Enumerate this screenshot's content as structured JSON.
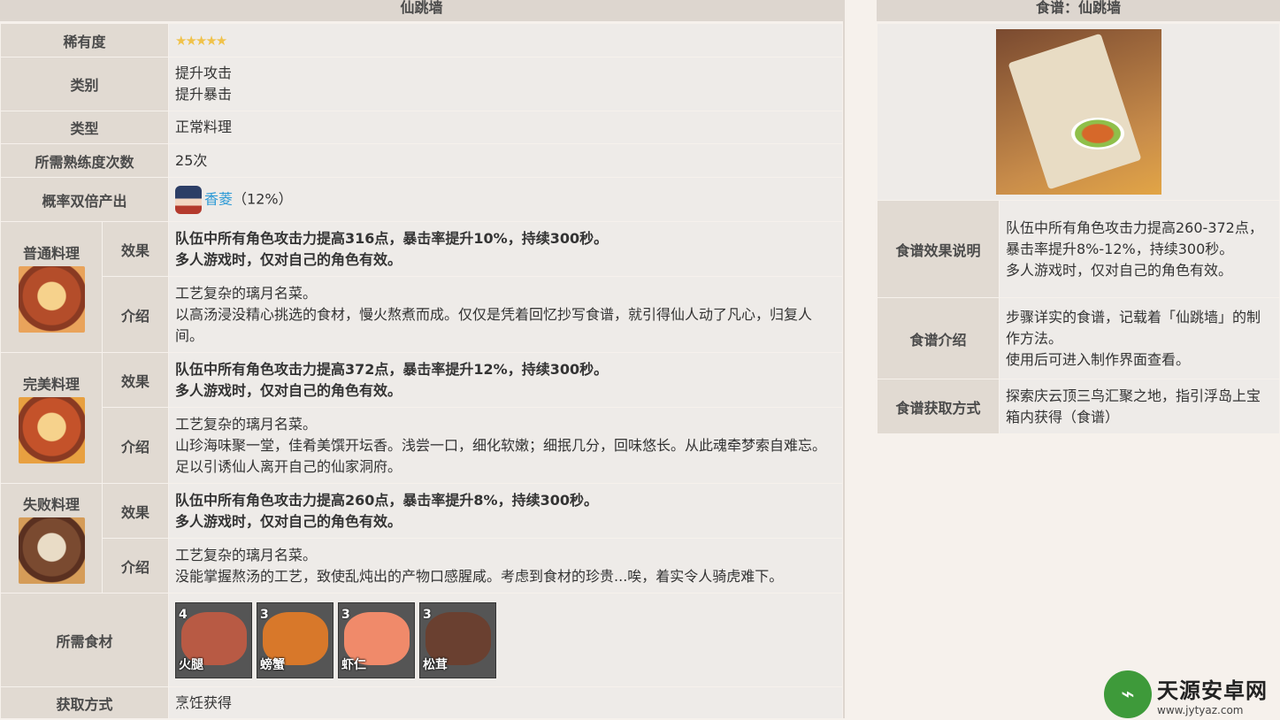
{
  "dish": {
    "title": "仙跳墙",
    "rarity_label": "稀有度",
    "rarity_stars": "★★★★★",
    "category_label": "类别",
    "category_lines": [
      "提升攻击",
      "提升暴击"
    ],
    "type_label": "类型",
    "type_value": "正常料理",
    "proficiency_label": "所需熟练度次数",
    "proficiency_value": "25次",
    "double_label": "概率双倍产出",
    "double_char": "香菱",
    "double_rate": "（12%）",
    "effect_label": "效果",
    "intro_label": "介绍",
    "variants": [
      {
        "name": "普通料理",
        "effect": [
          "队伍中所有角色攻击力提高316点，暴击率提升10%，持续300秒。",
          "多人游戏时，仅对自己的角色有效。"
        ],
        "intro": [
          "工艺复杂的璃月名菜。",
          "以高汤浸没精心挑选的食材，慢火熬煮而成。仅仅是凭着回忆抄写食谱，就引得仙人动了凡心，归复人间。"
        ]
      },
      {
        "name": "完美料理",
        "effect": [
          "队伍中所有角色攻击力提高372点，暴击率提升12%，持续300秒。",
          "多人游戏时，仅对自己的角色有效。"
        ],
        "intro": [
          "工艺复杂的璃月名菜。",
          "山珍海味聚一堂，佳肴美馔开坛香。浅尝一口，细化软嫩；细抿几分，回味悠长。从此魂牵梦索自难忘。足以引诱仙人离开自己的仙家洞府。"
        ]
      },
      {
        "name": "失败料理",
        "effect": [
          "队伍中所有角色攻击力提高260点，暴击率提升8%，持续300秒。",
          "多人游戏时，仅对自己的角色有效。"
        ],
        "intro": [
          "工艺复杂的璃月名菜。",
          "没能掌握熬汤的工艺，致使乱炖出的产物口感腥咸。考虑到食材的珍贵...唉，着实令人骑虎难下。"
        ]
      }
    ],
    "ingredients_label": "所需食材",
    "ingredients": [
      {
        "count": "4",
        "name": "火腿",
        "color": "#b85a44"
      },
      {
        "count": "3",
        "name": "螃蟹",
        "color": "#d8782a"
      },
      {
        "count": "3",
        "name": "虾仁",
        "color": "#f08a6a"
      },
      {
        "count": "3",
        "name": "松茸",
        "color": "#6a4030"
      }
    ],
    "source_label": "获取方式",
    "source_value": "烹饪获得"
  },
  "recipe": {
    "title": "食谱：仙跳墙",
    "effect_label": "食谱效果说明",
    "effect_lines": [
      "队伍中所有角色攻击力提高260-372点，暴击率提升8%-12%，持续300秒。",
      "多人游戏时，仅对自己的角色有效。"
    ],
    "intro_label": "食谱介绍",
    "intro_lines": [
      "步骤详实的食谱，记载着「仙跳墙」的制作方法。",
      "使用后可进入制作界面查看。"
    ],
    "source_label": "食谱获取方式",
    "source_value": "探索庆云顶三鸟汇聚之地，指引浮岛上宝箱内获得（食谱）"
  },
  "watermark": {
    "name": "天源安卓网",
    "url": "www.jytyaz.com"
  }
}
